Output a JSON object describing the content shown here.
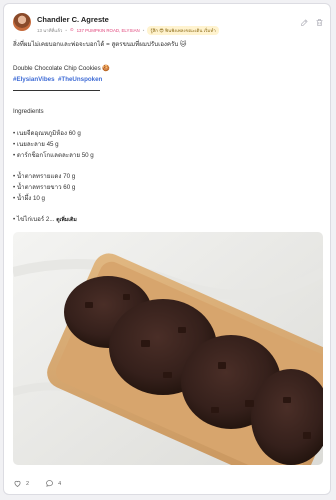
{
  "post": {
    "author": "Chandler C. Agreste",
    "meta": {
      "time": "13 นาทีที่แล้ว",
      "location": "137 PUMPKIN ROAD, ELYSIAN",
      "badge": "รู้สึก 😎 ฟินฟังเพลงขณะเดิน เริ่มทำ"
    },
    "text": {
      "intro": "สิ่งที่ผมไม่เคยบอกและพ่อจะบอกได้ = สูตรขนมที่ผมปรับเองครับ 🐱",
      "title": "Double Chocolate Chip Cookies 🍪",
      "hashtag_1": "#ElysianVibes",
      "hashtag_2": "#TheUnspoken",
      "ingredients_heading": "Ingredients",
      "ing_1": "• เนยจืดอุณหภูมิห้อง 60 g",
      "ing_2": "• เนยละลาย 45 g",
      "ing_3": "• ดาร์กช็อกโกแลตละลาย 50 g",
      "ing_4": "• น้ำตาลทรายแดง 70 g",
      "ing_5": "• น้ำตาลทรายขาว 60 g",
      "ing_6": "• น้ำผึ้ง 10 g",
      "ing_7": "• ไข่ไก่เบอร์ 2...",
      "see_more": "ดูเพิ่มเติม"
    },
    "likes_count": "2",
    "comments_count": "4"
  },
  "icons": {
    "edit": "pencil-icon",
    "delete": "trash-icon",
    "like": "heart-icon",
    "comment": "comment-icon",
    "location": "location-pin-icon"
  },
  "colors": {
    "hashtag": "#3f6cd6",
    "location": "#e0457b",
    "badge_bg": "#fff3cf"
  }
}
